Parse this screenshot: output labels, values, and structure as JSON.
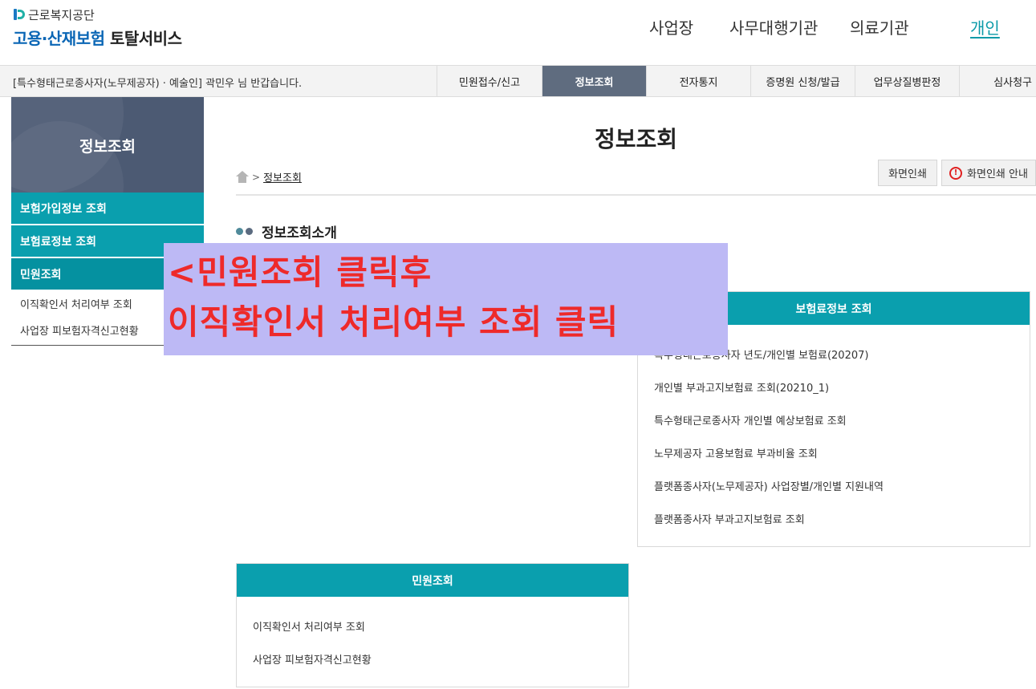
{
  "header": {
    "org_name": "근로복지공단",
    "service_brand": "고용·산재보험",
    "service_sub": "토탈서비스",
    "nav": [
      {
        "label": "사업장"
      },
      {
        "label": "사무대행기관"
      },
      {
        "label": "의료기관"
      },
      {
        "label": "개인",
        "active": true
      }
    ]
  },
  "graybar": {
    "welcome": "[특수형태근로종사자(노무제공자) · 예술인] 곽민우 님 반갑습니다.",
    "menu": [
      {
        "label": "민원접수/신고"
      },
      {
        "label": "정보조회",
        "active": true
      },
      {
        "label": "전자통지"
      },
      {
        "label": "증명원 신청/발급"
      },
      {
        "label": "업무상질병판정"
      },
      {
        "label": "심사청구"
      }
    ]
  },
  "sidebar": {
    "title": "정보조회",
    "items": [
      {
        "label": "보험가입정보 조회"
      },
      {
        "label": "보험료정보 조회"
      },
      {
        "label": "민원조회"
      }
    ],
    "subitems": [
      {
        "label": "이직확인서 처리여부 조회"
      },
      {
        "label": "사업장 피보험자격신고현황"
      }
    ]
  },
  "main": {
    "page_title": "정보조회",
    "breadcrumb": "정보조회",
    "print_button": "화면인쇄",
    "print_guide_button": "화면인쇄 안내",
    "section_title": "정보조회소개",
    "cards": {
      "premium": {
        "title": "보험료정보 조회",
        "items": [
          "특수형태근로종사자 년도/개인별 보험료(20207)",
          "개인별 부과고지보험료 조회(20210_1)",
          "특수형태근로종사자 개인별 예상보험료 조회",
          "노무제공자 고용보험료 부과비율 조회",
          "플랫폼종사자(노무제공자) 사업장별/개인별 지원내역",
          "플랫폼종사자 부과고지보험료 조회"
        ]
      },
      "civil": {
        "title": "민원조회",
        "items": [
          "이직확인서 처리여부 조회",
          "사업장 피보험자격신고현황"
        ]
      }
    }
  },
  "overlay": {
    "line1": "<민원조회 클릭후",
    "line2": "이직확인서 처리여부 조회 클릭"
  },
  "colors": {
    "teal": "#0a9fae",
    "slate": "#5f6c7f",
    "sidebar_head": "#4c5a73",
    "overlay_bg": "#bdb9f5",
    "overlay_text": "#ee2a2a"
  }
}
